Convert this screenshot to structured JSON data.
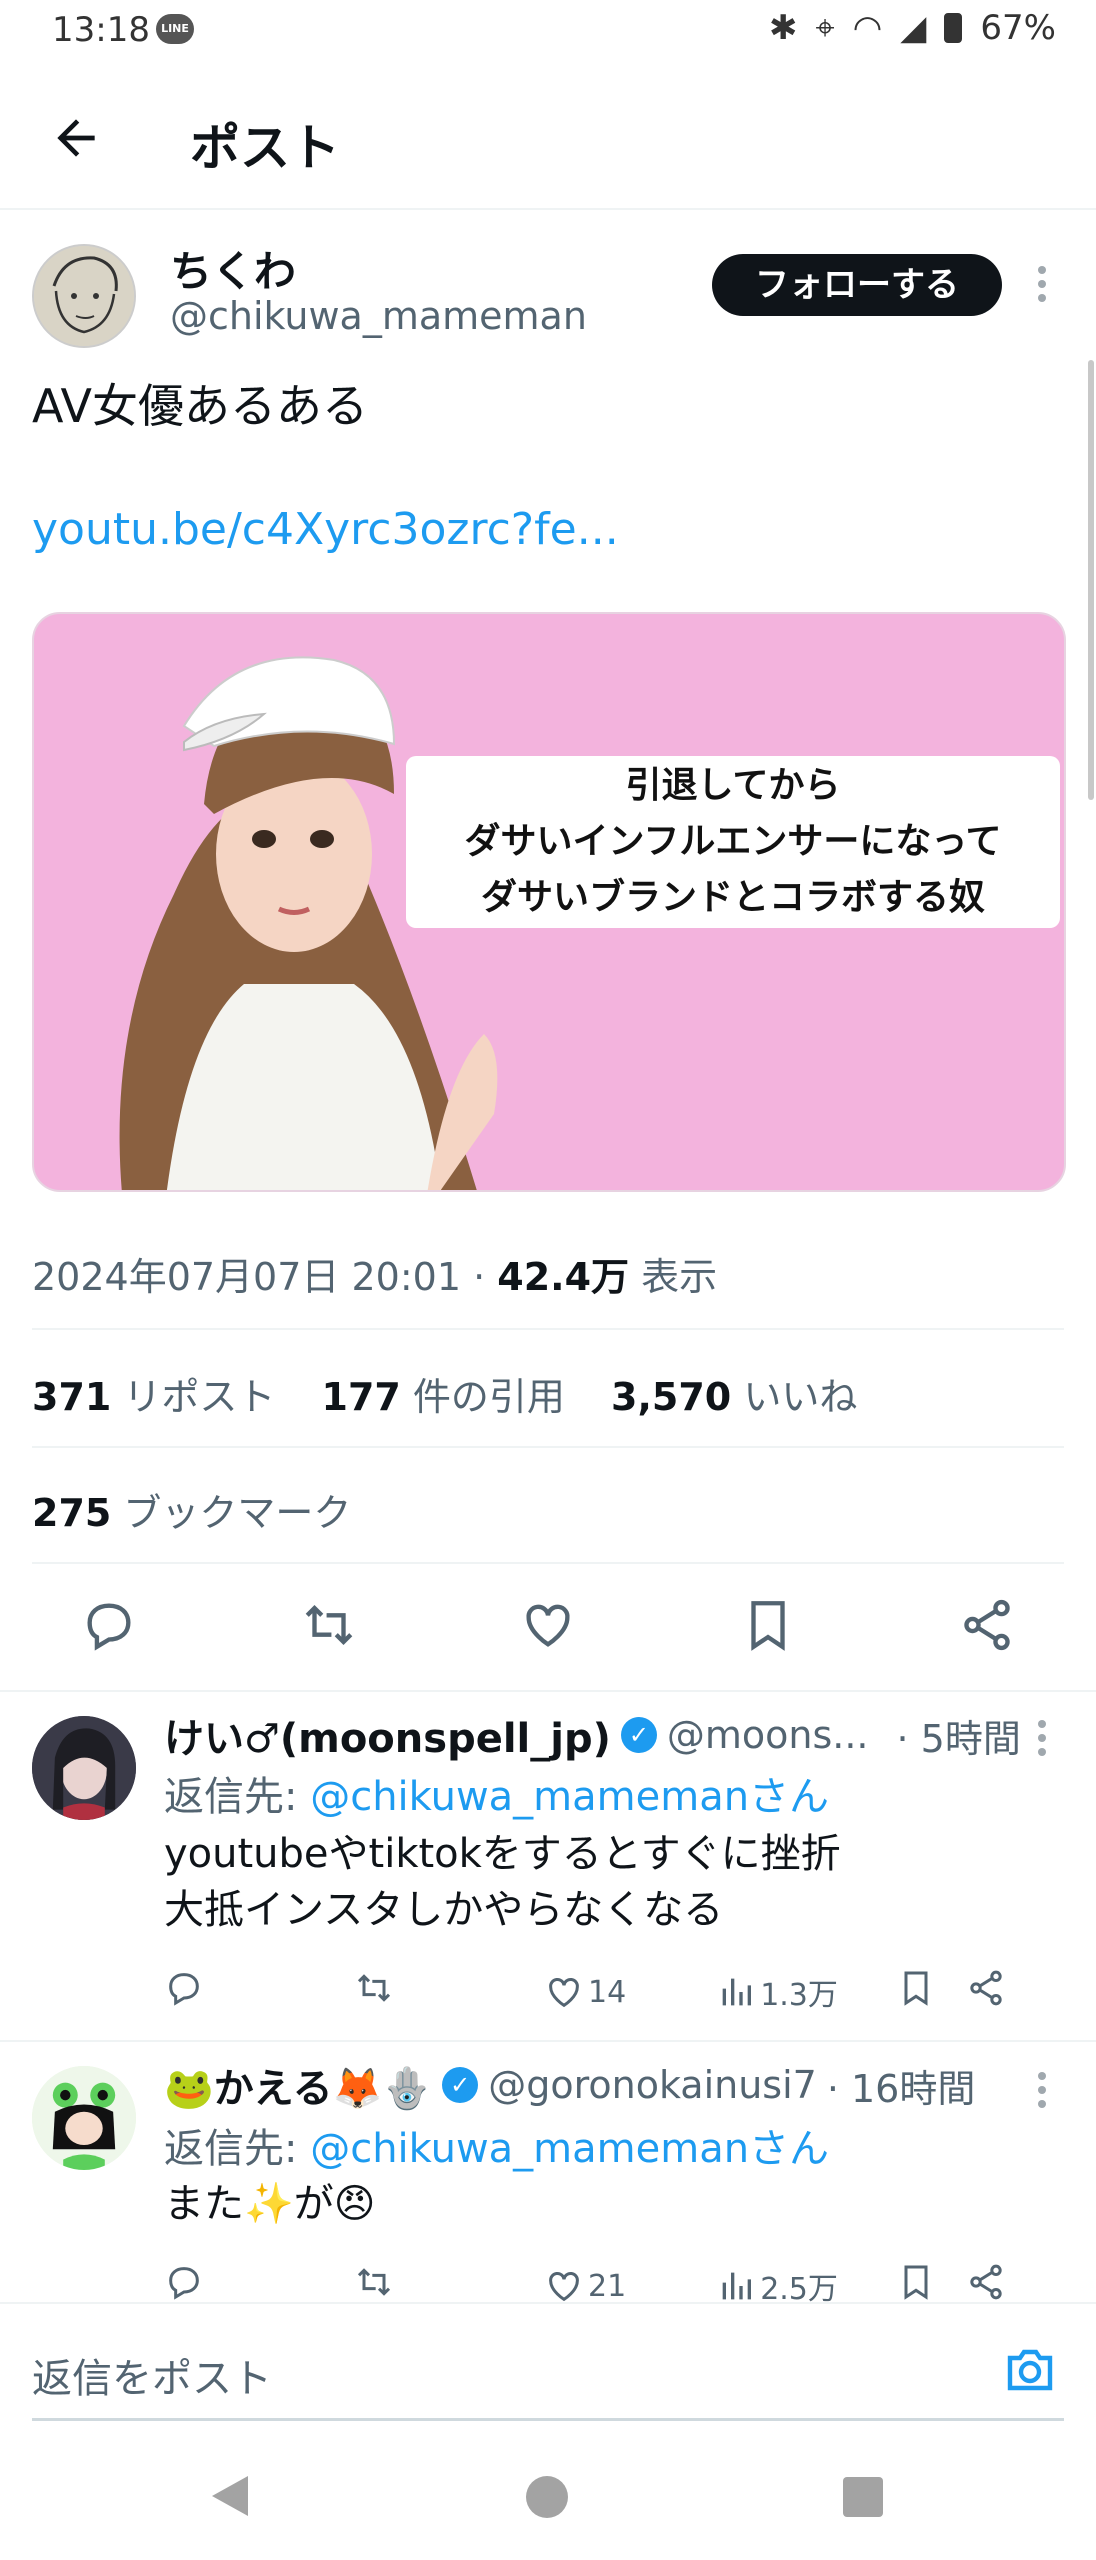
{
  "status_bar": {
    "time": "13:18",
    "line_badge": "LINE",
    "battery": "67%"
  },
  "header": {
    "title": "ポスト"
  },
  "post": {
    "author_name": "ちくわ",
    "author_handle": "@chikuwa_mameman",
    "follow_label": "フォローする",
    "text": "AV女優あるある",
    "link": "youtu.be/c4Xyrc3ozrc?fe...",
    "card_caption": [
      "引退してから",
      "ダサいインフルエンサーになって",
      "ダサいブランドとコラボする奴"
    ],
    "timestamp": "2024年07月07日 20:01 · ",
    "views_count": "42.4万",
    "views_label": " 表示",
    "reposts_count": "371",
    "reposts_label": " リポスト",
    "quotes_count": "177",
    "quotes_label": " 件の引用",
    "likes_count": "3,570",
    "likes_label": " いいね",
    "bookmarks_count": "275",
    "bookmarks_label": " ブックマーク"
  },
  "replies": [
    {
      "name": "けい♂(moonspell_jp)",
      "handle": "@moons...",
      "time": "· 5時間",
      "reply_prefix": "返信先: ",
      "reply_to": "@chikuwa_mamemanさん",
      "text_lines": [
        "youtubeやtiktokをするとすぐに挫折",
        "大抵インスタしかやらなくなる"
      ],
      "likes": "14",
      "views": "1.3万"
    },
    {
      "name": "🐸かえる🦊🪬",
      "handle": "@goronokainusi7",
      "time": "· 16時間",
      "reply_prefix": "返信先: ",
      "reply_to": "@chikuwa_mamemanさん",
      "text_lines": [
        "また✨が😠"
      ],
      "likes": "21",
      "views": "2.5万"
    }
  ],
  "compose": {
    "placeholder": "返信をポスト"
  },
  "colors": {
    "accent": "#1d9bf0",
    "card_bg": "#f3b3dd",
    "text": "#0f1419",
    "muted": "#536471"
  }
}
